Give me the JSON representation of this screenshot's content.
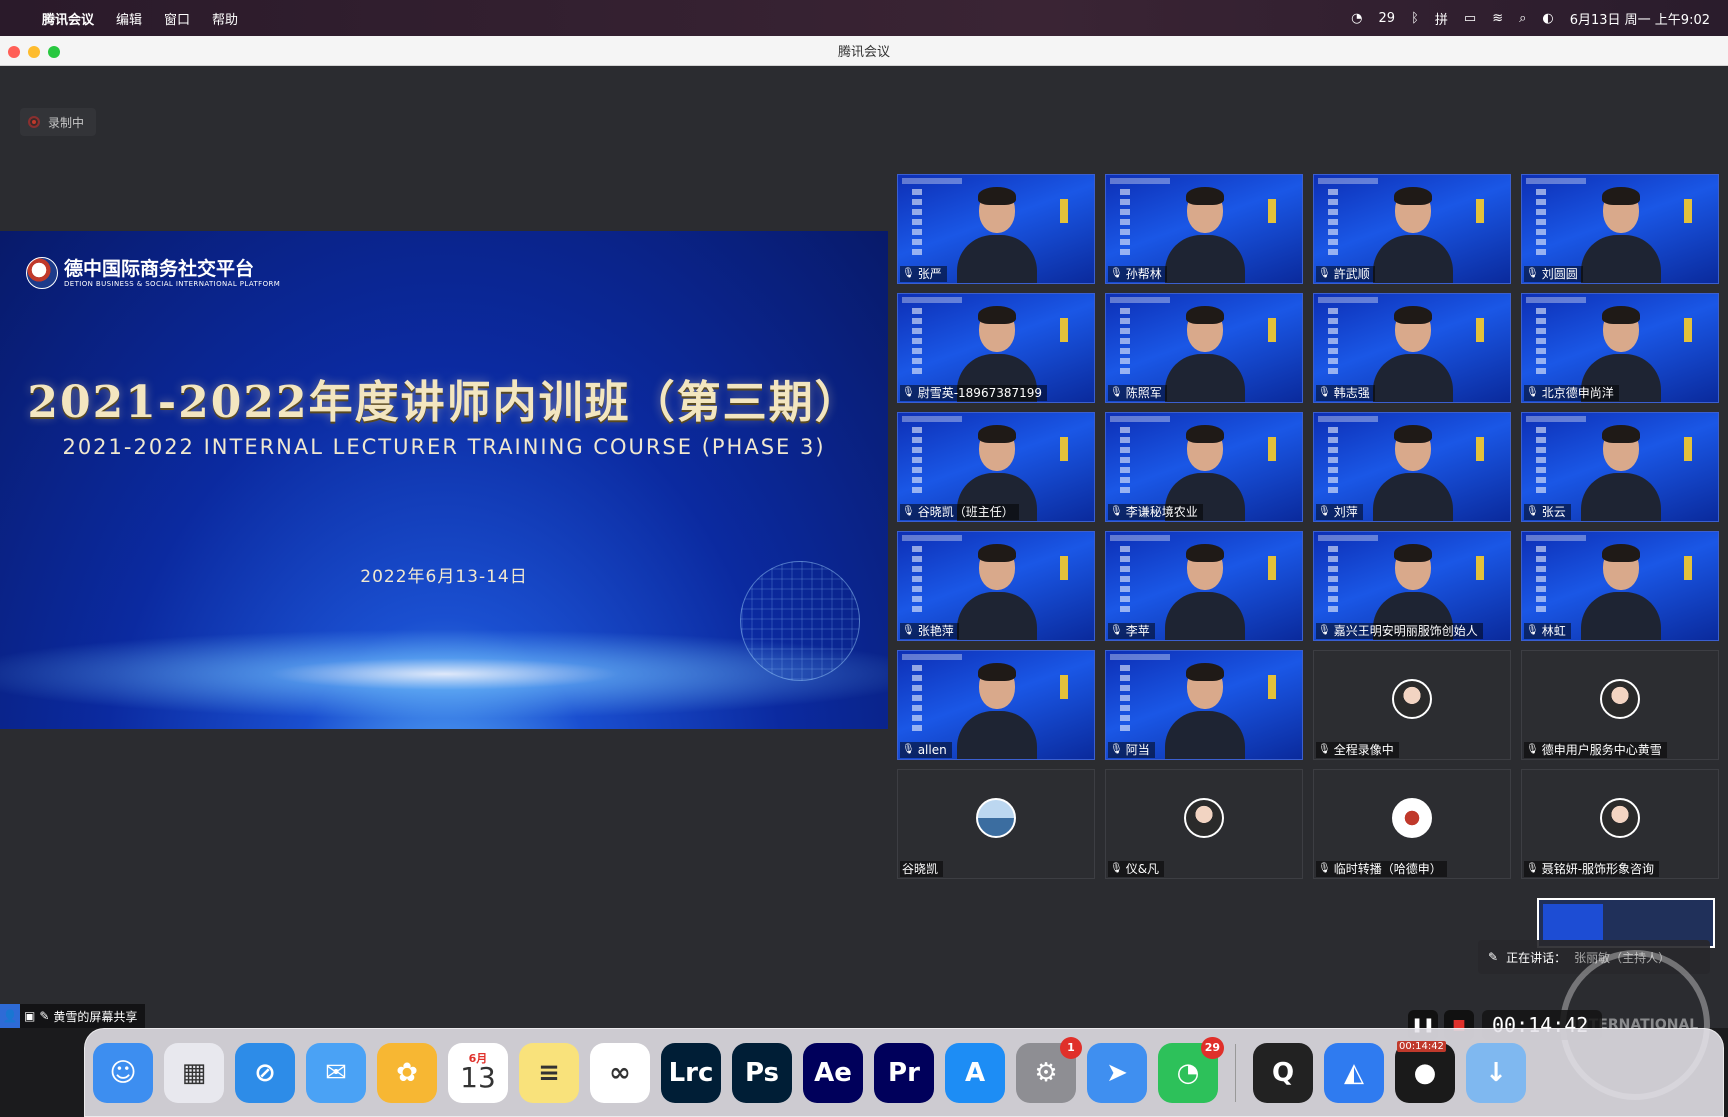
{
  "menubar": {
    "app_name": "腾讯会议",
    "menus": [
      "编辑",
      "窗口",
      "帮助"
    ],
    "wechat_count": "29",
    "datetime": "6月13日 周一 上午9:02"
  },
  "window": {
    "title": "腾讯会议"
  },
  "recording_badge": {
    "label": "录制中"
  },
  "slide": {
    "logo_cn": "德中国际商务社交平台",
    "logo_en": "DETION BUSINESS & SOCIAL INTERNATIONAL PLATFORM",
    "title_cn": "2021-2022年度讲师内训班（第三期）",
    "title_en": "2021-2022 INTERNAL LECTURER TRAINING COURSE (PHASE 3)",
    "date": "2022年6月13-14日"
  },
  "share_label": "黄雪的屏幕共享",
  "participants": [
    {
      "name": "张严",
      "video": true
    },
    {
      "name": "孙帮林",
      "video": true
    },
    {
      "name": "許武顺",
      "video": true
    },
    {
      "name": "刘圆圆",
      "video": true
    },
    {
      "name": "尉雪英-18967387199",
      "video": true
    },
    {
      "name": "陈照军",
      "video": true
    },
    {
      "name": "韩志强",
      "video": true
    },
    {
      "name": "北京德申尚洋",
      "video": true
    },
    {
      "name": "谷晓凯（班主任）",
      "video": true
    },
    {
      "name": "李谦秘境农业",
      "video": true
    },
    {
      "name": "刘萍",
      "video": true
    },
    {
      "name": "张云",
      "video": true
    },
    {
      "name": "张艳萍",
      "video": true
    },
    {
      "name": "李苹",
      "video": true
    },
    {
      "name": "嘉兴王明安明丽服饰创始人",
      "video": true
    },
    {
      "name": "林虹",
      "video": true
    },
    {
      "name": "allen",
      "video": true
    },
    {
      "name": "阿当",
      "video": true
    },
    {
      "name": "全程录像中",
      "video": false,
      "avatar": "person"
    },
    {
      "name": "德申用户服务中心黄雪",
      "video": false,
      "avatar": "person"
    },
    {
      "name": "谷晓凯",
      "video": false,
      "avatar": "land"
    },
    {
      "name": "仪&凡",
      "video": false,
      "avatar": "person"
    },
    {
      "name": "临时转播（哈德申）",
      "video": false,
      "avatar": "logo"
    },
    {
      "name": "聂铭妍-服饰形象咨询",
      "video": false,
      "avatar": "person"
    }
  ],
  "speaking": {
    "prefix": "正在讲话：",
    "name": "张丽敏（主持人）"
  },
  "recording_controls": {
    "timer": "00:14:42",
    "dock_timer": "00:14:42"
  },
  "watermark": "INTERNATIONAL",
  "dock": {
    "apps": [
      {
        "name": "Finder",
        "glyph": "☺",
        "color": "#3d8ef0"
      },
      {
        "name": "Launchpad",
        "glyph": "▦",
        "color": "#e8e8ee"
      },
      {
        "name": "Safari",
        "glyph": "⊘",
        "color": "#2d8ce8"
      },
      {
        "name": "Mail",
        "glyph": "✉",
        "color": "#4aa2f5"
      },
      {
        "name": "Photos",
        "glyph": "✿",
        "color": "#f7b733"
      },
      {
        "name": "Calendar",
        "glyph": "13",
        "color": "#ffffff"
      },
      {
        "name": "Notes",
        "glyph": "≡",
        "color": "#f9e27b"
      },
      {
        "name": "Baidu Netdisk",
        "glyph": "∞",
        "color": "#ffffff"
      },
      {
        "name": "Lightroom Classic",
        "glyph": "Lrc",
        "color": "#001e36"
      },
      {
        "name": "Photoshop",
        "glyph": "Ps",
        "color": "#001e36"
      },
      {
        "name": "After Effects",
        "glyph": "Ae",
        "color": "#00005b"
      },
      {
        "name": "Premiere Pro",
        "glyph": "Pr",
        "color": "#00005b"
      },
      {
        "name": "App Store",
        "glyph": "A",
        "color": "#1d8df5"
      },
      {
        "name": "System Preferences",
        "glyph": "⚙",
        "color": "#8e8e93",
        "badge": "1"
      },
      {
        "name": "Feishu",
        "glyph": "➤",
        "color": "#3f8ff0"
      },
      {
        "name": "WeChat",
        "glyph": "◔",
        "color": "#2dc15a",
        "badge": "29"
      },
      {
        "name": "QuickTime",
        "glyph": "Q",
        "color": "#222"
      },
      {
        "name": "Tencent Meeting",
        "glyph": "◭",
        "color": "#2f7bf0"
      },
      {
        "name": "Screen Recorder",
        "glyph": "●",
        "color": "#1a1a1a"
      },
      {
        "name": "Downloads",
        "glyph": "↓",
        "color": "#7fb8f0"
      }
    ],
    "calendar_month": "6月"
  }
}
